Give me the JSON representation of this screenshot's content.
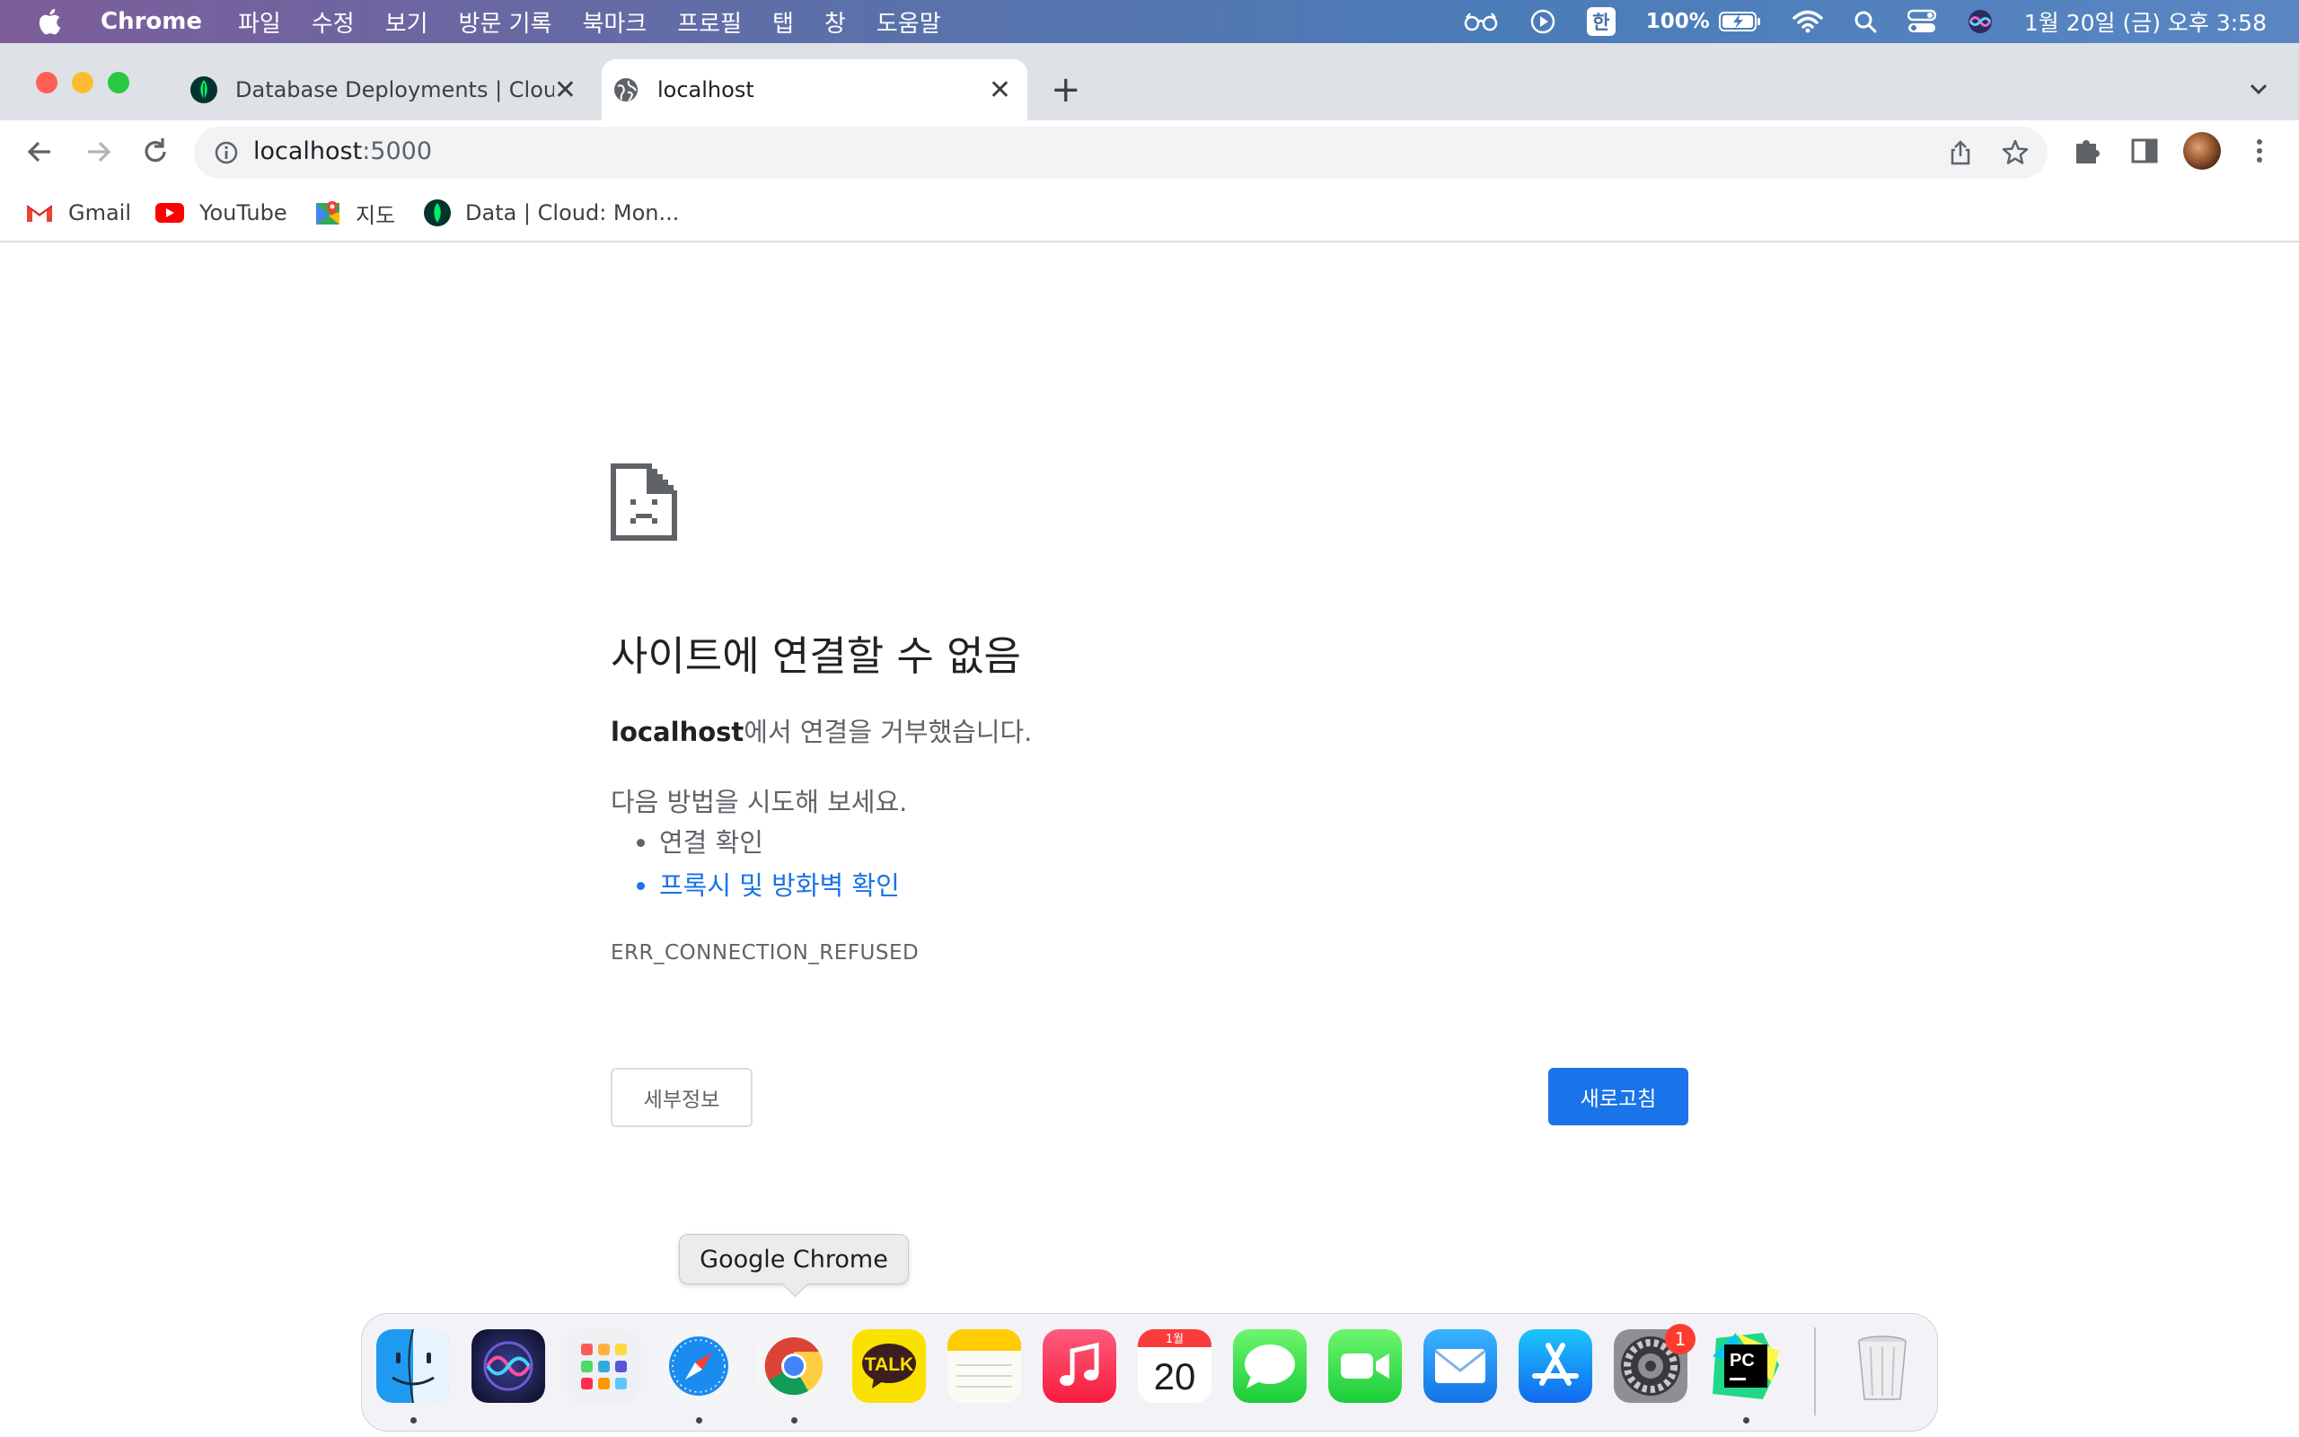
{
  "menubar": {
    "app_name": "Chrome",
    "menus": [
      "파일",
      "수정",
      "보기",
      "방문 기록",
      "북마크",
      "프로필",
      "탭",
      "창",
      "도움말"
    ],
    "ime": "한",
    "battery": "100%",
    "datetime": "1월 20일 (금) 오후 3:58"
  },
  "tabs": [
    {
      "title": "Database Deployments | Cloud",
      "active": false
    },
    {
      "title": "localhost",
      "active": true
    }
  ],
  "omnibox": {
    "host": "localhost",
    "port": ":5000"
  },
  "bookmarks": [
    {
      "label": "Gmail",
      "icon": "gmail-icon"
    },
    {
      "label": "YouTube",
      "icon": "youtube-icon"
    },
    {
      "label": "지도",
      "icon": "maps-icon"
    },
    {
      "label": "Data | Cloud: Mon...",
      "icon": "mongodb-leaf-icon"
    }
  ],
  "error": {
    "heading": "사이트에 연결할 수 없음",
    "host_bold": "localhost",
    "summary_rest": "에서 연결을 거부했습니다.",
    "suggest_intro": "다음 방법을 시도해 보세요.",
    "suggestions": [
      "연결 확인",
      "프록시 및 방화벽 확인"
    ],
    "code": "ERR_CONNECTION_REFUSED",
    "details_button": "세부정보",
    "reload_button": "새로고침"
  },
  "dock": {
    "tooltip": "Google Chrome",
    "calendar_month": "1월",
    "calendar_day": "20",
    "kakao_label": "TALK",
    "pycharm_label": "PC",
    "settings_badge": "1",
    "apps": [
      "Finder",
      "Siri",
      "Launchpad",
      "Safari",
      "Google Chrome",
      "KakaoTalk",
      "Notes",
      "Music",
      "Calendar",
      "Messages",
      "FaceTime",
      "Mail",
      "App Store",
      "System Preferences",
      "PyCharm",
      "Trash"
    ]
  },
  "colors": {
    "accent": "#1a73e8",
    "tabstrip": "#dee1e6",
    "error_text": "#5f6368"
  }
}
